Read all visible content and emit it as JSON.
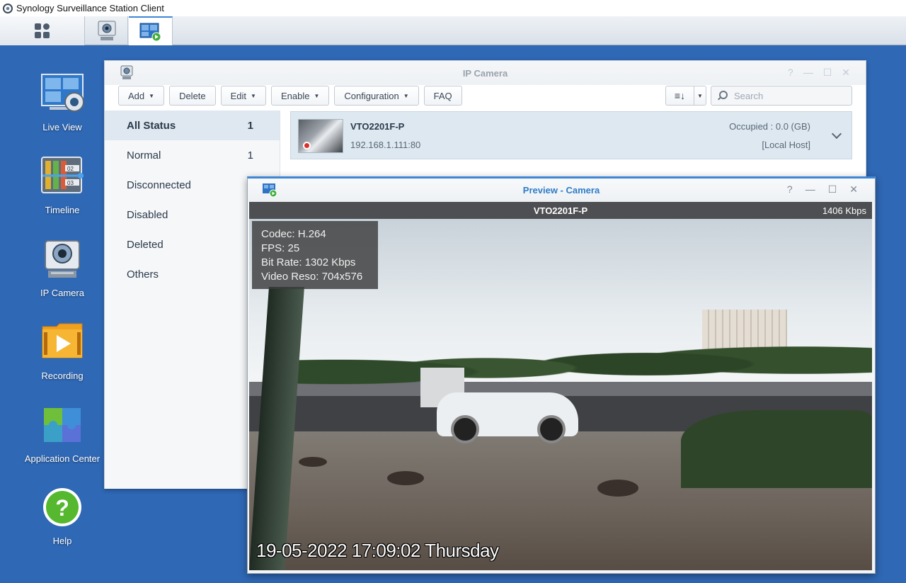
{
  "os": {
    "title": "Synology Surveillance Station Client"
  },
  "taskbar": {
    "items": [
      "main-menu",
      "ip-camera",
      "preview"
    ]
  },
  "desktop": {
    "items": [
      {
        "label": "Live View",
        "icon": "live-view-icon"
      },
      {
        "label": "Timeline",
        "icon": "timeline-icon"
      },
      {
        "label": "IP Camera",
        "icon": "ip-camera-icon"
      },
      {
        "label": "Recording",
        "icon": "recording-icon"
      },
      {
        "label": "Application Center",
        "icon": "application-center-icon"
      },
      {
        "label": "Help",
        "icon": "help-icon"
      }
    ],
    "timeline_badges": [
      "02",
      "03"
    ]
  },
  "ipcamera": {
    "title": "IP Camera",
    "toolbar": {
      "add": "Add",
      "delete": "Delete",
      "edit": "Edit",
      "enable": "Enable",
      "configuration": "Configuration",
      "faq": "FAQ"
    },
    "search_placeholder": "Search",
    "sidebar": [
      {
        "label": "All Status",
        "count": "1"
      },
      {
        "label": "Normal",
        "count": "1"
      },
      {
        "label": "Disconnected",
        "count": ""
      },
      {
        "label": "Disabled",
        "count": ""
      },
      {
        "label": "Deleted",
        "count": ""
      },
      {
        "label": "Others",
        "count": ""
      }
    ],
    "camera": {
      "name": "VTO2201F-P",
      "address": "192.168.1.111:80",
      "occupied": "Occupied : 0.0 (GB)",
      "host": "[Local Host]"
    }
  },
  "preview": {
    "title": "Preview - Camera",
    "camera_name": "VTO2201F-P",
    "bitrate_display": "1406 Kbps",
    "osd": [
      "Codec: H.264",
      "FPS: 25",
      "Bit Rate: 1302 Kbps",
      "Video Reso: 704x576"
    ],
    "timestamp": "19-05-2022 17:09:02 Thursday"
  },
  "colors": {
    "desktop": "#2f68b5",
    "accent": "#3f86d6",
    "title_blue": "#2e7cc8",
    "recording_red": "#d8302a"
  }
}
